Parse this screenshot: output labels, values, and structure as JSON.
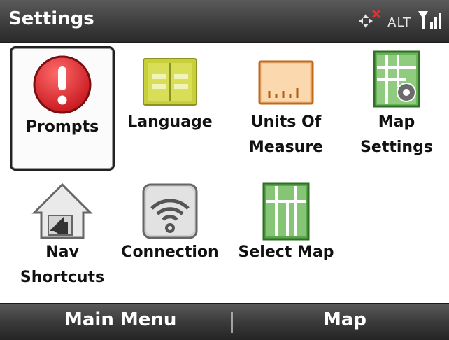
{
  "title_bar": {
    "title": "Settings",
    "status_alt": "ALT"
  },
  "settings_items": [
    {
      "label_line1": "Prompts",
      "label_line2": "",
      "icon": "exclamation-icon"
    },
    {
      "label_line1": "Language",
      "label_line2": "",
      "icon": "book-icon"
    },
    {
      "label_line1": "Units Of",
      "label_line2": "Measure",
      "icon": "ruler-icon"
    },
    {
      "label_line1": "Map",
      "label_line2": "Settings",
      "icon": "map-settings-icon"
    },
    {
      "label_line1": "Nav",
      "label_line2": "Shortcuts",
      "icon": "home-shortcut-icon"
    },
    {
      "label_line1": "Connection",
      "label_line2": "",
      "icon": "wireless-icon"
    },
    {
      "label_line1": "Select Map",
      "label_line2": "",
      "icon": "select-map-icon"
    }
  ],
  "selected_item": "Prompts",
  "softkeys": {
    "left": "Main Menu",
    "right": "Map"
  },
  "colors": {
    "title_bar": "#3e3e3e",
    "prompts_red": "#d7262b",
    "language_yellow": "#c9cf3a",
    "units_orange": "#e07f2a",
    "map_green": "#4f9a3e"
  }
}
